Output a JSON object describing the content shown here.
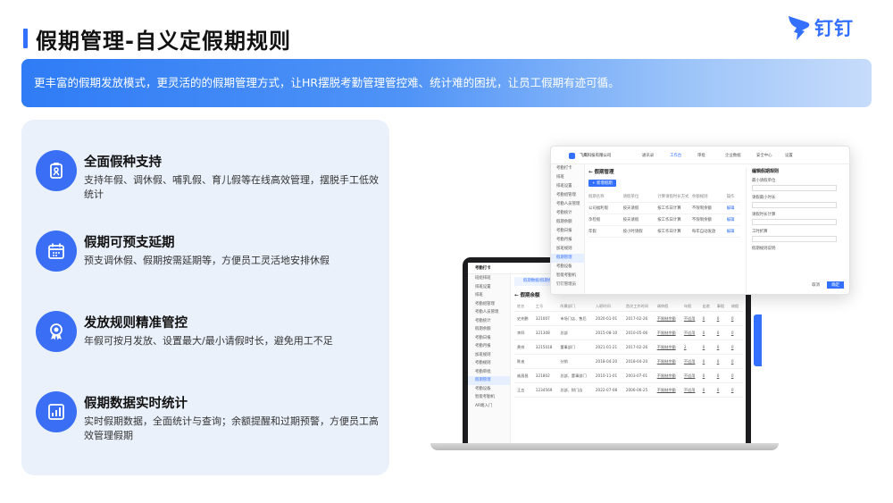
{
  "header": {
    "title": "假期管理-自义定假期规则",
    "logo_text": "钉钉"
  },
  "banner": {
    "text": "更丰富的假期发放模式，更灵活的的假期管理方式，让HR摆脱考勤管理管控难、统计难的困扰，让员工假期有迹可循。"
  },
  "features": [
    {
      "icon": "badge-icon",
      "title": "全面假种支持",
      "desc": "支持年假、调休假、哺乳假、育儿假等在线高效管理，摆脱手工低效统计"
    },
    {
      "icon": "calendar-icon",
      "title": "假期可预支延期",
      "desc": "预支调休假、假期按需延期等，方便员工灵活地安排休假"
    },
    {
      "icon": "award-icon",
      "title": "发放规则精准管控",
      "desc": "年假可按月发放、设置最大/最小请假时长，避免用工不足"
    },
    {
      "icon": "chart-icon",
      "title": "假期数据实时统计",
      "desc": "实时假期数据，全面统计与查询；余额提醒和过期预警，方便员工高效管理假期"
    }
  ],
  "laptop": {
    "app": "考勤打卡",
    "side_items": [
      "班组排班",
      "排班设置",
      "排班",
      "考勤组管理",
      "考勤人员管理",
      "考勤统计",
      "假期余额",
      "考勤日报",
      "考勤月报",
      "加班规则",
      "考勤规则",
      "考勤审批",
      "假期管理",
      "考勤设备",
      "智能考勤机",
      "AR端入门"
    ],
    "notice": "假期数据/假期余额说明",
    "page_title": "← 假期余额",
    "headers": [
      "姓名",
      "工号",
      "所属部门",
      "入职时间",
      "首次工作时间",
      "调休假",
      "年假",
      "出差",
      "事假",
      "病假"
    ],
    "rows": [
      [
        "史先鹏",
        "321007",
        "市场门店、售后",
        "2020-01-01",
        "2017-02-26",
        "不限制余额",
        "不适用",
        "0",
        "0",
        "0"
      ],
      [
        "李四",
        "321308",
        "总部",
        "2015-08-10",
        "2010-05-06",
        "不限制余额",
        "不适用",
        "0",
        "0",
        "0"
      ],
      [
        "黄祥",
        "3215018",
        "董事部门",
        "2021-01-21",
        "2017-02-26",
        "不限制余额",
        "2",
        "0",
        "0",
        "0"
      ],
      [
        "陈迪",
        "",
        "分销",
        "2018-04-20",
        "2018-04-20",
        "不限制余额",
        "不适用",
        "0",
        "0",
        "0"
      ],
      [
        "戚昌昌",
        "321802",
        "总部、董事部门",
        "2010-11-01",
        "2003-07-01",
        "不限制余额",
        "不适用",
        "0",
        "0",
        "0"
      ],
      [
        "王五",
        "1234569",
        "总部、财门店",
        "2022-07-08",
        "2006-06-25",
        "不限制余额",
        "不适用",
        "0",
        "0",
        "0"
      ]
    ]
  },
  "popup": {
    "company": "飞鹰科技有限公司",
    "top_tabs": [
      "通讯录",
      "工作台",
      "审批",
      "企业数据",
      "安全中心",
      "设置"
    ],
    "side_items": [
      "考勤打卡",
      "排班",
      "排班设置",
      "考勤组管理",
      "考勤人员管理",
      "考勤统计",
      "假期余额",
      "考勤日报",
      "考勤月报",
      "加班规则",
      "假期管理",
      "考勤设备",
      "智能考勤机",
      "钉钉管理员"
    ],
    "page_title": "← 假期管理",
    "add_button": "+ 新增假期",
    "headers": [
      "假期名称",
      "请假单位",
      "计算请假时长方式",
      "余额规则",
      "操作"
    ],
    "rows": [
      [
        "公司福利假",
        "按天请假",
        "按工作日计算",
        "不限制余额",
        "编辑"
      ],
      [
        "孕检假",
        "按天请假",
        "按工作日计算",
        "不限制余额",
        "编辑"
      ],
      [
        "年假",
        "按小时请假",
        "按工作日计算",
        "每年自动发放",
        "编辑"
      ]
    ],
    "right": {
      "title": "编辑假期规则",
      "labels": [
        "最小请假单位",
        "请假最小时长",
        "请假时长计算",
        "工时折算",
        "假期规则说明"
      ],
      "cancel": "取消",
      "ok": "确定"
    }
  }
}
